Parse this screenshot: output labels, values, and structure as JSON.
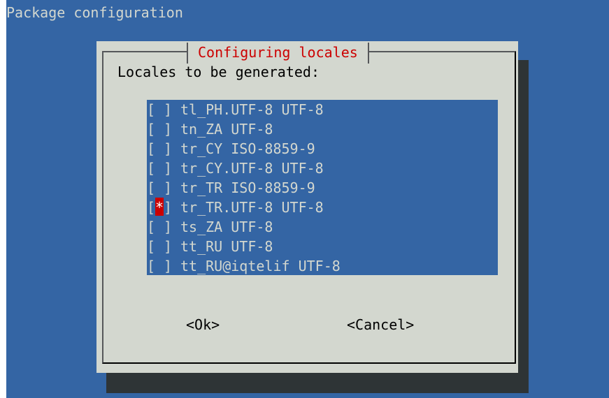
{
  "backtitle": "Package configuration",
  "dialog": {
    "title": "Configuring locales",
    "prompt": "Locales to be generated:"
  },
  "locales": [
    {
      "label": "tl_PH.UTF-8 UTF-8",
      "checked": false
    },
    {
      "label": "tn_ZA UTF-8",
      "checked": false
    },
    {
      "label": "tr_CY ISO-8859-9",
      "checked": false
    },
    {
      "label": "tr_CY.UTF-8 UTF-8",
      "checked": false
    },
    {
      "label": "tr_TR ISO-8859-9",
      "checked": false
    },
    {
      "label": "tr_TR.UTF-8 UTF-8",
      "checked": true
    },
    {
      "label": "ts_ZA UTF-8",
      "checked": false
    },
    {
      "label": "tt_RU UTF-8",
      "checked": false
    },
    {
      "label": "tt_RU@iqtelif UTF-8",
      "checked": false
    }
  ],
  "checkbox": {
    "open": "[",
    "close": "]",
    "checked_mark": "*",
    "unchecked_mark": " "
  },
  "buttons": {
    "ok": "<Ok>",
    "cancel": "<Cancel>"
  },
  "colors": {
    "desktop": "#3465a4",
    "dialog": "#d3d7cf",
    "title": "#cc0000",
    "shadow": "#2e3436",
    "selected_mark": "#cc0000"
  }
}
